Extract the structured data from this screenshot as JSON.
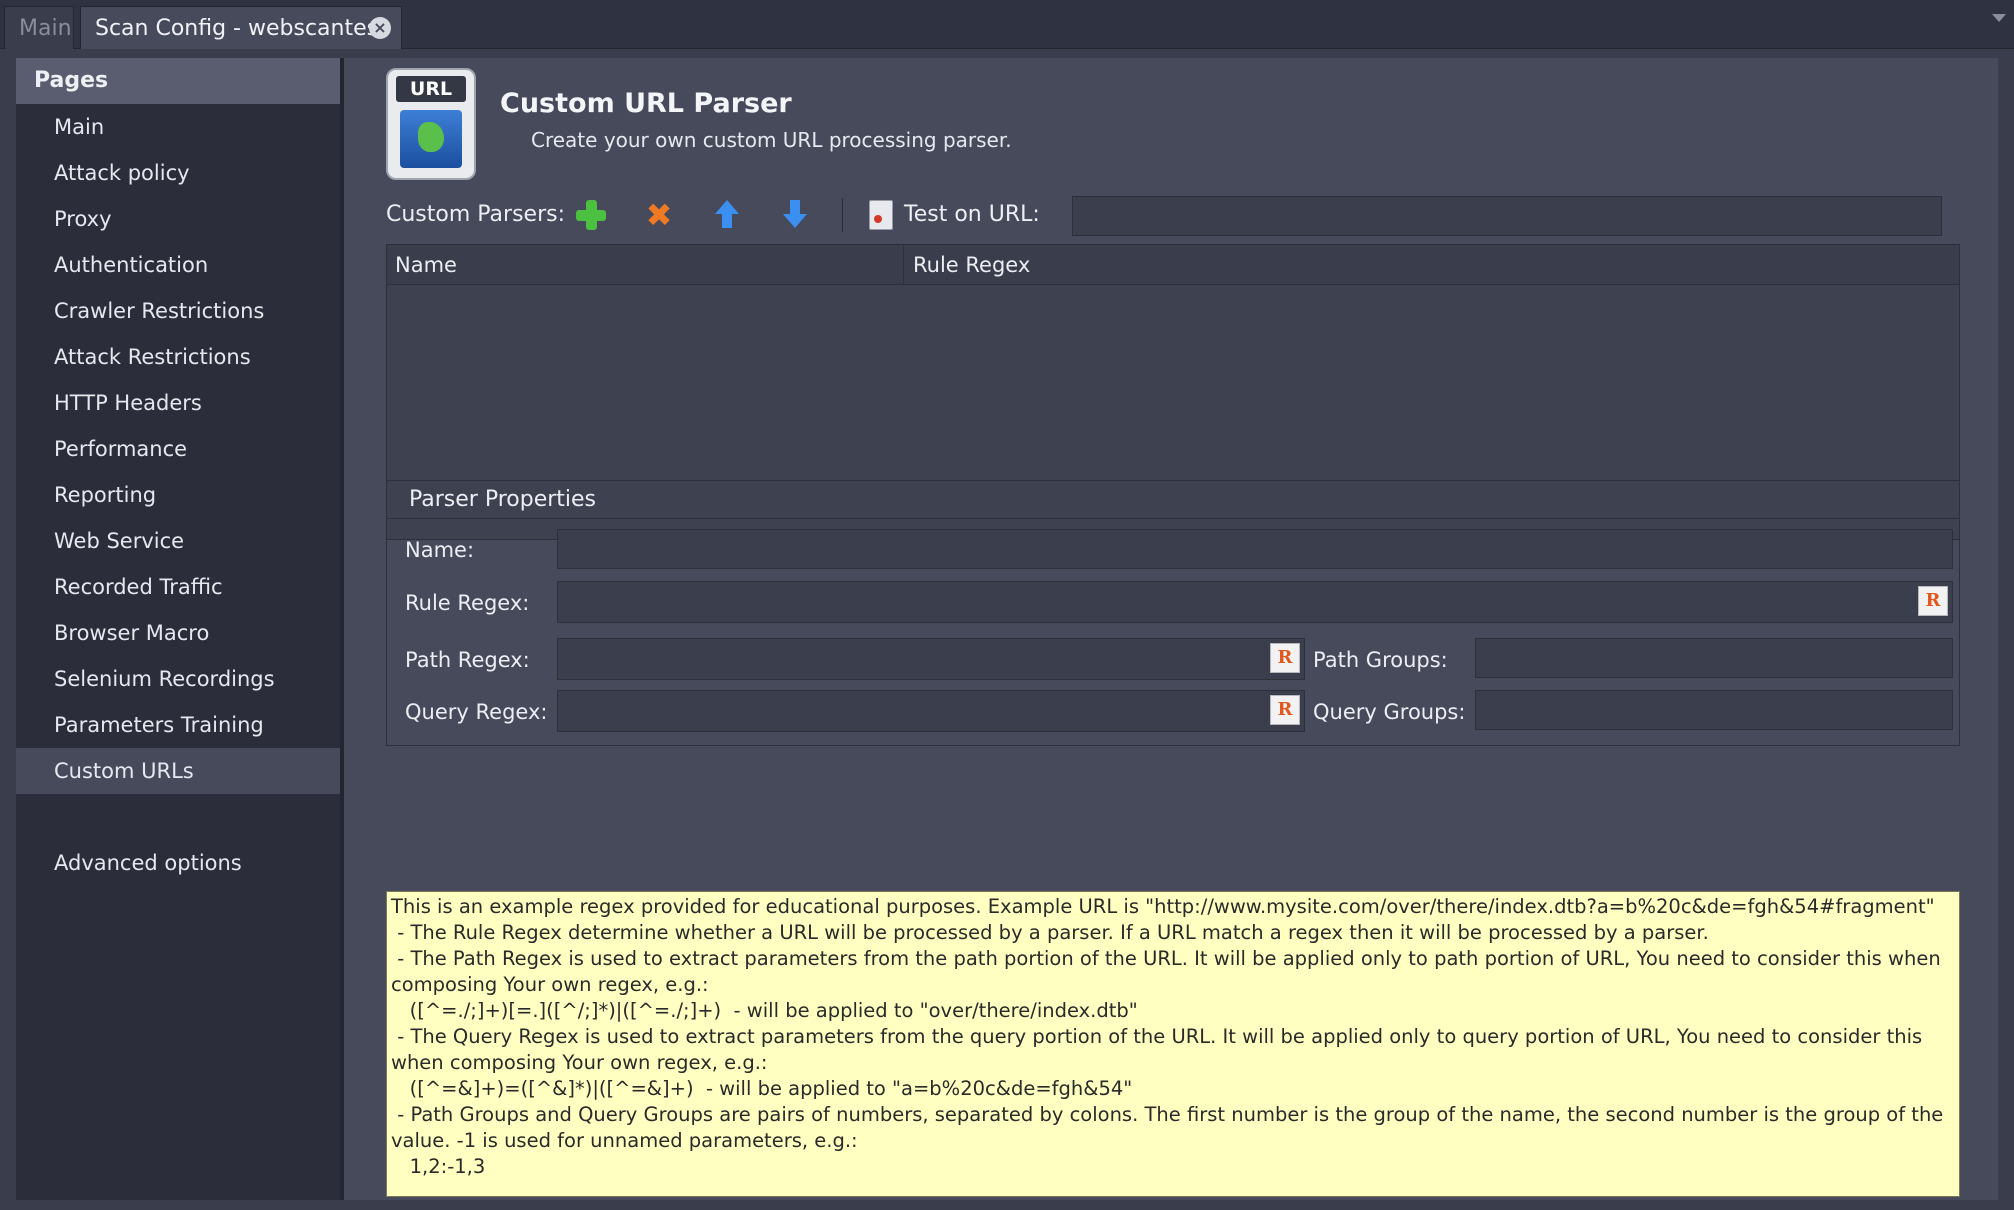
{
  "tabs": [
    {
      "label": "Main"
    },
    {
      "label": "Scan Config - webscantest"
    }
  ],
  "sidebar": {
    "header": "Pages",
    "items": [
      {
        "label": "Main"
      },
      {
        "label": "Attack policy"
      },
      {
        "label": "Proxy"
      },
      {
        "label": "Authentication"
      },
      {
        "label": "Crawler Restrictions"
      },
      {
        "label": "Attack Restrictions"
      },
      {
        "label": "HTTP Headers"
      },
      {
        "label": "Performance"
      },
      {
        "label": "Reporting"
      },
      {
        "label": "Web Service"
      },
      {
        "label": "Recorded Traffic"
      },
      {
        "label": "Browser Macro"
      },
      {
        "label": "Selenium Recordings"
      },
      {
        "label": "Parameters Training"
      },
      {
        "label": "Custom URLs"
      }
    ],
    "active_item": "Custom URLs",
    "advanced": "Advanced options"
  },
  "page": {
    "title": "Custom URL Parser",
    "subtitle": "Create your own custom URL processing parser.",
    "logo_text": "URL"
  },
  "toolbar": {
    "label": "Custom Parsers:",
    "icons": [
      "plus-icon",
      "delete-icon",
      "arrow-up-icon",
      "arrow-down-icon",
      "document-icon"
    ],
    "test_label": "Test on URL:",
    "test_value": ""
  },
  "table": {
    "columns": [
      "Name",
      "Rule Regex"
    ],
    "rows": []
  },
  "properties": {
    "title": "Parser Properties",
    "name_label": "Name:",
    "rule_regex_label": "Rule Regex:",
    "path_regex_label": "Path Regex:",
    "query_regex_label": "Query Regex:",
    "path_groups_label": "Path Groups:",
    "query_groups_label": "Query Groups:",
    "name_value": "",
    "rule_regex_value": "",
    "path_regex_value": "",
    "query_regex_value": "",
    "path_groups_value": "",
    "query_groups_value": "",
    "regex_icon_text": "R"
  },
  "help": {
    "text": "This is an example regex provided for educational purposes. Example URL is \"http://www.mysite.com/over/there/index.dtb?a=b%20c&de=fgh&54#fragment\"\n - The Rule Regex determine whether a URL will be processed by a parser. If a URL match a regex then it will be processed by a parser.\n - The Path Regex is used to extract parameters from the path portion of the URL. It will be applied only to path portion of URL, You need to consider this when\ncomposing Your own regex, e.g.:\n   ([^=./;]+)[=.]([^/;]*)|([^=./;]+)  - will be applied to \"over/there/index.dtb\"\n - The Query Regex is used to extract parameters from the query portion of the URL. It will be applied only to query portion of URL, You need to consider this\nwhen composing Your own regex, e.g.:\n   ([^=&]+)=([^&]*)|([^=&]+)  - will be applied to \"a=b%20c&de=fgh&54\"\n - Path Groups and Query Groups are pairs of numbers, separated by colons. The first number is the group of the name, the second number is the group of the\nvalue. -1 is used for unnamed parameters, e.g.:\n   1,2:-1,3"
  },
  "colors": {
    "background": "#3a3d4c",
    "panel": "#474a5b",
    "sidebar": "#2b2d3a",
    "help_background": "#ffffc2"
  }
}
